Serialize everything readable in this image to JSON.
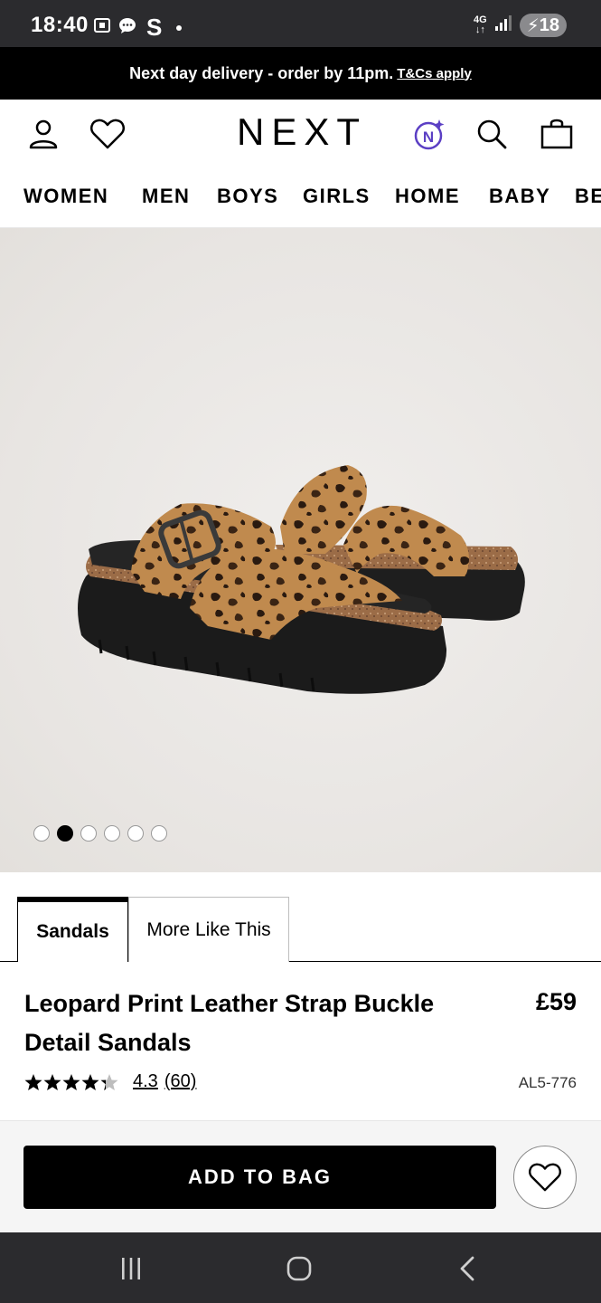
{
  "status_bar": {
    "time": "18:40",
    "carrier_letter": "S",
    "network": "4G",
    "battery": "18"
  },
  "promo": {
    "text": "Next day delivery - order by 11pm.",
    "link": "T&Cs apply"
  },
  "header": {
    "logo": "NEXT",
    "icons": [
      "account-icon",
      "wishlist-icon",
      "next-ai-icon",
      "search-icon",
      "bag-icon"
    ]
  },
  "nav": {
    "items": [
      "WOMEN",
      "MEN",
      "BOYS",
      "GIRLS",
      "HOME",
      "BABY",
      "BE"
    ]
  },
  "gallery": {
    "image_count": 6,
    "active_index": 1
  },
  "tabs": {
    "active": "Sandals",
    "other": "More Like This"
  },
  "product": {
    "title": "Leopard Print Leather Strap Buckle Detail Sandals",
    "price": "£59",
    "rating": "4.3",
    "rating_value": 4.3,
    "review_count": "(60)",
    "sku": "AL5-776"
  },
  "actions": {
    "add_to_bag": "ADD TO BAG"
  },
  "colors": {
    "status_bar_bg": "#2b2b2e",
    "promo_bg": "#000000",
    "primary_button": "#000000",
    "page_bg": "#ffffff"
  }
}
